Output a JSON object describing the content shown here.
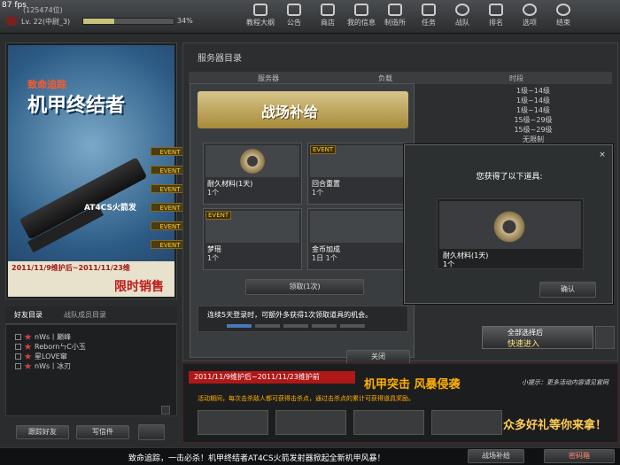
{
  "fps": "87 fps",
  "player": {
    "id": "(125474位)",
    "level": "Lv. 22(中尉_3)",
    "xp_percent": 34,
    "xp_label": "34%"
  },
  "nav": [
    {
      "label": "教程大纲",
      "icon": "tutorial-icon"
    },
    {
      "label": "公告",
      "icon": "megaphone-icon"
    },
    {
      "label": "商店",
      "icon": "shop-icon"
    },
    {
      "label": "我的信息",
      "icon": "profile-icon"
    },
    {
      "label": "制造所",
      "icon": "craft-icon"
    },
    {
      "label": "任务",
      "icon": "mission-icon"
    },
    {
      "label": "战队",
      "icon": "clan-icon"
    },
    {
      "label": "排名",
      "icon": "trophy-icon"
    },
    {
      "label": "选项",
      "icon": "gear-icon"
    },
    {
      "label": "结束",
      "icon": "power-icon"
    }
  ],
  "promo": {
    "subtitle": "致命追踪",
    "title": "机甲终结者",
    "gun": "AT4CS火箭发",
    "date": "2011/11/9维护后~2011/11/23维",
    "limited": "限时销售"
  },
  "events": [
    "EVENT",
    "EVENT",
    "EVENT",
    "EVENT",
    "EVENT",
    "EVENT"
  ],
  "friends": {
    "tab1": "好友目录",
    "tab2": "战队成员目录",
    "list": [
      "nWs丨巅峰",
      "RebornㄣC小玉",
      "星LOVE窜",
      "nWs丨冰刃"
    ],
    "add_btn": "跟踪好友",
    "mail_btn": "写信件"
  },
  "server": {
    "title": "服务器目录",
    "col_server": "服务器",
    "col_load": "负载",
    "col_time": "时段",
    "times": [
      "1级~14级",
      "1级~14级",
      "1级~14级",
      "15级~29级",
      "15级~29级",
      "无限制"
    ]
  },
  "supply": {
    "title": "战场补给",
    "items": [
      {
        "name": "耐久材料(1天)",
        "qty": "1个",
        "event": ""
      },
      {
        "name": "回合重置",
        "qty": "1个",
        "event": "EVENT"
      },
      {
        "name": "梦瑶",
        "qty": "1个",
        "event": "EVENT"
      },
      {
        "name": "金币加成",
        "qty": "1日 1个",
        "event": ""
      }
    ],
    "claim": "领取(1次)",
    "note": "连续5天登录时，可额外多获得1次领取道具的机会。",
    "close": "关闭"
  },
  "dialog": {
    "title": "您获得了以下道具:",
    "item_name": "耐久材料(1天)",
    "item_qty": "1个",
    "confirm": "确认",
    "close_icon": "×"
  },
  "quick": {
    "line1": "全部选择后",
    "line2": "快速进入"
  },
  "strip": {
    "date": "2011/11/9维护后~2011/11/23维护前",
    "title": "机甲突击 风暴侵袭",
    "tip": "小提示：更多活动内容请见官网",
    "desc": "活动期间，每次击杀敌人都可获得击杀点，通过击杀点的累计可获得道具奖励。",
    "cheer": "众多好礼等你来拿！"
  },
  "footer": {
    "ticker": "致命追踪，一击必杀！机甲终结者AT4CS火箭发射器掀起全新机甲风暴！",
    "supply_btn": "战场补给",
    "password_btn": "密码箱"
  }
}
